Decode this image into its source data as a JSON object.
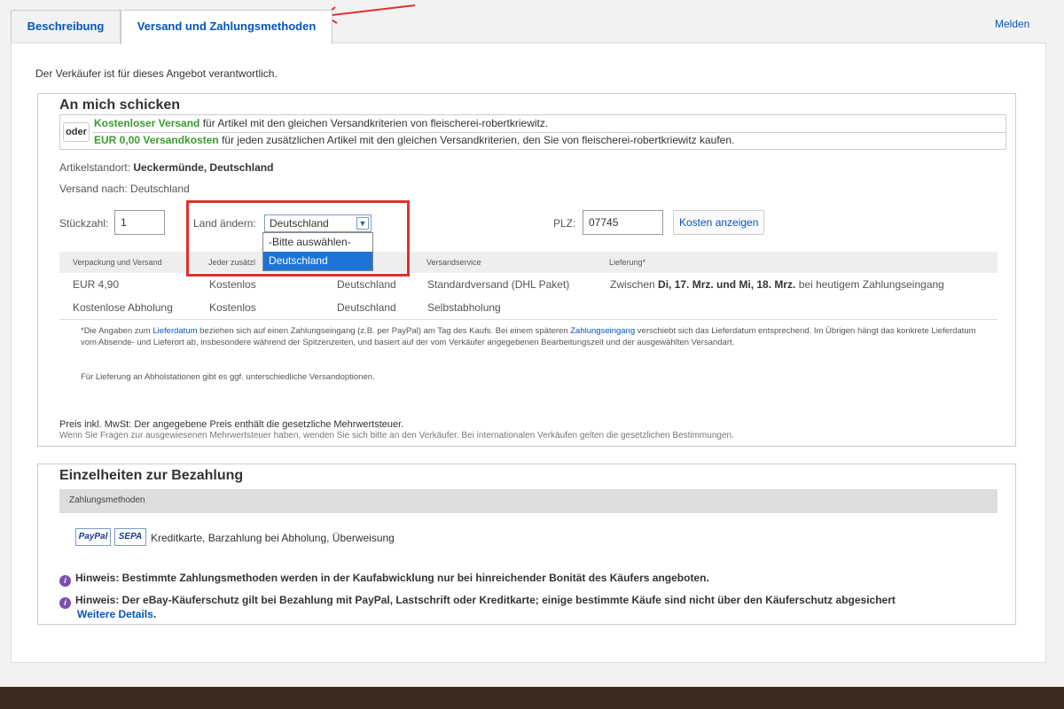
{
  "tabs": [
    {
      "label": "Beschreibung"
    },
    {
      "label": "Versand und Zahlungsmethoden"
    }
  ],
  "report_link": "Melden",
  "responsible_text": "Der Verkäufer ist für dieses Angebot verantwortlich.",
  "shipping": {
    "heading": "An mich schicken",
    "oder": "oder",
    "line1_highlight": "Kostenloser Versand",
    "line1_text": " für Artikel mit den gleichen Versandkriterien von fleischerei-robertkriewitz.",
    "line2_highlight": "EUR 0,00 Versandkosten",
    "line2_text": " für jeden zusätzlichen Artikel mit den gleichen Versandkriterien, den Sie von fleischerei-robertkriewitz kaufen.",
    "location_label": "Artikelstandort: ",
    "location_value": "Ueckermünde, Deutschland",
    "ship_to": "Versand nach: Deutschland",
    "qty_label": "Stückzahl:",
    "qty_value": "1",
    "country_label": "Land ändern:",
    "country_value": "Deutschland",
    "country_options": [
      "-Bitte auswählen-",
      "Deutschland"
    ],
    "plz_label": "PLZ:",
    "plz_value": "07745",
    "cost_button": "Kosten anzeigen",
    "table_headers": [
      "Verpackung und Versand",
      "Jeder zusätzl",
      "Versandservice",
      "Lieferung*"
    ],
    "rows": [
      {
        "cost": "EUR 4,90",
        "each": "Kostenlos",
        "to": "Deutschland",
        "service": "Standardversand (DHL Paket)",
        "delivery_pre": "Zwischen ",
        "delivery_bold": "Di, 17. Mrz. und Mi, 18. Mrz.",
        "delivery_post": " bei heutigem Zahlungseingang"
      },
      {
        "cost": "Kostenlose Abholung",
        "each": "Kostenlos",
        "to": "Deutschland",
        "service": "Selbstabholung",
        "delivery_pre": "",
        "delivery_bold": "",
        "delivery_post": ""
      }
    ],
    "note_p1": "*Die Angaben zum ",
    "note_link1": "Lieferdatum",
    "note_p2": " beziehen sich auf einen Zahlungseingang (z.B. per PayPal) am Tag des Kaufs. Bei einem späteren ",
    "note_link2": "Zahlungseingang",
    "note_p3": " verschiebt sich das Lieferdatum entsprechend. Im Übrigen hängt das konkrete Lieferdatum vom Absende- und Lieferort ab, insbesondere während der Spitzenzeiten, und basiert auf der vom Verkäufer angegebenen Bearbeitungszeit und der ausgewählten Versandart.",
    "note2": "Für Lieferung an Abholstationen gibt es ggf. unterschiedliche Versandoptionen.",
    "mwst": "Preis inkl. MwSt: Der angegebene Preis enthält die gesetzliche Mehrwertsteuer.",
    "mwst2": "Wenn Sie Fragen zur ausgewiesenen Mehrwertsteuer haben, wenden Sie sich bitte an den Verkäufer. Bei internationalen Verkäufen gelten die gesetzlichen Bestimmungen."
  },
  "payment": {
    "heading": "Einzelheiten zur Bezahlung",
    "methods_header": "Zahlungsmethoden",
    "badge_paypal": "PayPal",
    "badge_sepa": "SEPA",
    "methods_text": "Kreditkarte, Barzahlung bei Abholung, Überweisung",
    "hint1": "Hinweis: Bestimmte Zahlungsmethoden werden in der Kaufabwicklung nur bei hinreichender Bonität des Käufers angeboten.",
    "hint2": "Hinweis: Der eBay-Käuferschutz gilt bei Bezahlung mit PayPal, Lastschrift oder Kreditkarte; einige bestimmte Käufe sind nicht über den Käuferschutz abgesichert",
    "hint2_link": "Weitere Details",
    "info_icon_text": "i"
  },
  "colors": {
    "link": "#0654ba",
    "green": "#3a9b2e",
    "annotation_red": "#e03030"
  }
}
